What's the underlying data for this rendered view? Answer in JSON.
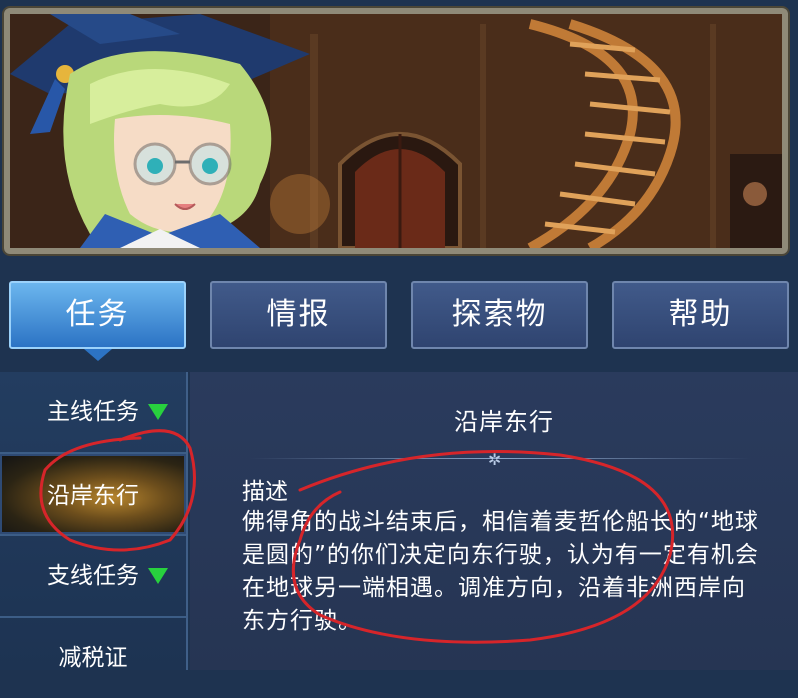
{
  "tabs": [
    {
      "label": "任务",
      "active": true
    },
    {
      "label": "情报",
      "active": false
    },
    {
      "label": "探索物",
      "active": false
    },
    {
      "label": "帮助",
      "active": false
    }
  ],
  "nav": {
    "items": [
      {
        "label": "主线任务",
        "arrow": true
      },
      {
        "label": "沿岸东行",
        "selected": true
      },
      {
        "label": "支线任务",
        "arrow": true
      },
      {
        "label": "减税证"
      }
    ]
  },
  "quest": {
    "title": "沿岸东行",
    "desc_label": "描述",
    "description": "佛得角的战斗结束后，相信着麦哲伦船长的“地球是圆的”的你们决定向东行驶，认为有一定有机会在地球另一端相遇。调准方向，沿着非洲西岸向东方行驶。"
  },
  "colors": {
    "active_tab": "#2c73c4",
    "tab": "#36507e",
    "arrow": "#28d13e",
    "annotation": "#d6252a"
  }
}
